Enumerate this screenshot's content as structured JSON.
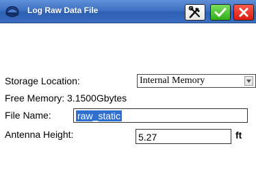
{
  "window": {
    "title": "Log Raw Data File",
    "app_icon": "helmet-icon"
  },
  "toolbar": {
    "tools_icon": "tools-icon",
    "ok_icon": "checkmark-icon",
    "cancel_icon": "close-icon",
    "ok_color": "#2fae1a",
    "cancel_color": "#d81a12"
  },
  "form": {
    "storage_location_label": "Storage Location:",
    "storage_location_value": "Internal Memory",
    "free_memory_text": "Free Memory: 3.1500Gbytes",
    "file_name_label": "File Name:",
    "file_name_value": "raw_static",
    "antenna_height_label": "Antenna Height:",
    "antenna_height_value": "5.27",
    "antenna_height_unit": "ft"
  }
}
